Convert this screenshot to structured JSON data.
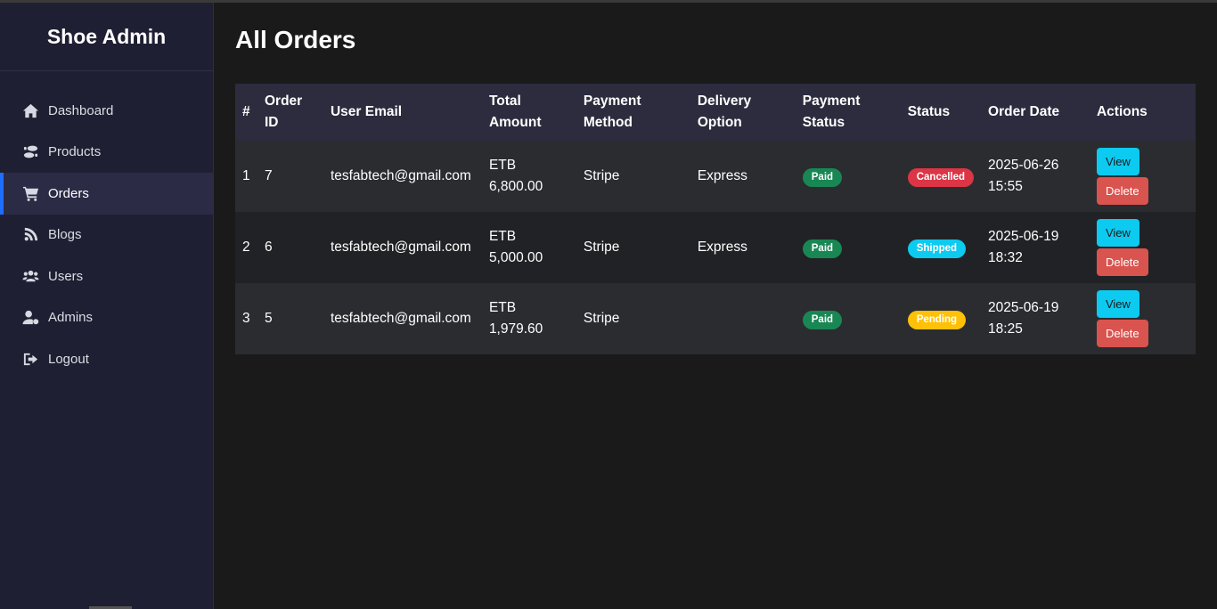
{
  "sidebar": {
    "brand": "Shoe Admin",
    "items": [
      {
        "label": "Dashboard",
        "icon": "home-icon"
      },
      {
        "label": "Products",
        "icon": "shoe-prints-icon"
      },
      {
        "label": "Orders",
        "icon": "cart-icon",
        "active": true
      },
      {
        "label": "Blogs",
        "icon": "blog-icon"
      },
      {
        "label": "Users",
        "icon": "users-icon"
      },
      {
        "label": "Admins",
        "icon": "user-cog-icon"
      },
      {
        "label": "Logout",
        "icon": "logout-icon"
      }
    ]
  },
  "main": {
    "title": "All Orders",
    "table": {
      "headers": [
        "#",
        "Order ID",
        "User Email",
        "Total Amount",
        "Payment Method",
        "Delivery Option",
        "Payment Status",
        "Status",
        "Order Date",
        "Actions"
      ],
      "rows": [
        {
          "index": "1",
          "order_id": "7",
          "email": "tesfabtech@gmail.com",
          "total": "ETB 6,800.00",
          "method": "Stripe",
          "delivery": "Express",
          "payment_status": "Paid",
          "status": "Cancelled",
          "date": "2025-06-26",
          "time": "15:55",
          "view": "View",
          "delete": "Delete"
        },
        {
          "index": "2",
          "order_id": "6",
          "email": "tesfabtech@gmail.com",
          "total": "ETB 5,000.00",
          "method": "Stripe",
          "delivery": "Express",
          "payment_status": "Paid",
          "status": "Shipped",
          "date": "2025-06-19",
          "time": "18:32",
          "view": "View",
          "delete": "Delete"
        },
        {
          "index": "3",
          "order_id": "5",
          "email": "tesfabtech@gmail.com",
          "total": "ETB 1,979.60",
          "method": "Stripe",
          "delivery": "",
          "payment_status": "Paid",
          "status": "Pending",
          "date": "2025-06-19",
          "time": "18:25",
          "view": "View",
          "delete": "Delete"
        }
      ]
    }
  },
  "colors": {
    "sidebar_bg": "#1f1f33",
    "page_bg": "#1a1a1a",
    "accent": "#1e6fff",
    "paid": "#198754",
    "cancelled": "#dc3545",
    "shipped": "#0dcaf0",
    "pending": "#ffc107",
    "delete": "#d9534f"
  }
}
